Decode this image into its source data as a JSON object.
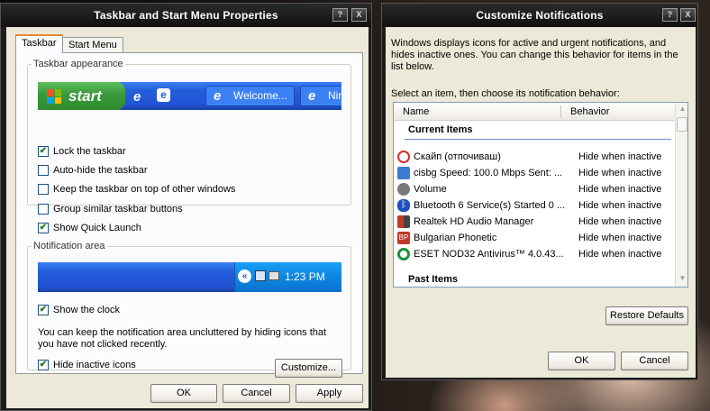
{
  "taskbar_window": {
    "title": "Taskbar and Start Menu Properties",
    "help_btn": "?",
    "close_btn": "X",
    "tabs": [
      "Taskbar",
      "Start Menu"
    ],
    "appearance_group": "Taskbar appearance",
    "preview": {
      "start": "start",
      "button1": "Welcome...",
      "button2": "Nin"
    },
    "options": [
      {
        "label": "Lock the taskbar",
        "checked": true
      },
      {
        "label": "Auto-hide the taskbar",
        "checked": false
      },
      {
        "label": "Keep the taskbar on top of other windows",
        "checked": false
      },
      {
        "label": "Group similar taskbar buttons",
        "checked": false
      },
      {
        "label": "Show Quick Launch",
        "checked": true
      }
    ],
    "notification_group": "Notification area",
    "clock_preview": "1:23 PM",
    "show_clock": "Show the clock",
    "info_text": "You can keep the notification area uncluttered by hiding icons that you have not clicked recently.",
    "hide_inactive": "Hide inactive icons",
    "customize": "Customize...",
    "ok": "OK",
    "cancel": "Cancel",
    "apply": "Apply"
  },
  "notify_window": {
    "title": "Customize Notifications",
    "help_btn": "?",
    "close_btn": "X",
    "description": "Windows displays icons for active and urgent notifications, and hides inactive ones. You can change this behavior for items in the list below.",
    "select_prompt": "Select an item, then choose its notification behavior:",
    "col_name": "Name",
    "col_behavior": "Behavior",
    "current_items": "Current Items",
    "past_items": "Past Items",
    "items": [
      {
        "name": "Скайп (отпочиваш)",
        "behavior": "Hide when inactive",
        "icon": "skype-icon",
        "color": "#d62e2e"
      },
      {
        "name": "cisbg Speed: 100.0 Mbps Sent: ...",
        "behavior": "Hide when inactive",
        "icon": "network-icon",
        "color": "#3a7bd5"
      },
      {
        "name": "Volume",
        "behavior": "Hide when inactive",
        "icon": "volume-icon",
        "color": "#7a7a7a"
      },
      {
        "name": "Bluetooth 6 Service(s) Started 0 ...",
        "behavior": "Hide when inactive",
        "icon": "bluetooth-icon",
        "color": "#1f4fbf"
      },
      {
        "name": "Realtek HD Audio Manager",
        "behavior": "Hide when inactive",
        "icon": "realtek-icon",
        "color": "#c0392b"
      },
      {
        "name": "Bulgarian Phonetic",
        "behavior": "Hide when inactive",
        "icon": "keyboard-layout-icon",
        "color": "#c0392b"
      },
      {
        "name": "ESET NOD32 Antivirus™ 4.0.43...",
        "behavior": "Hide when inactive",
        "icon": "eset-icon",
        "color": "#1f8f3a"
      }
    ],
    "restore_defaults": "Restore Defaults",
    "ok": "OK",
    "cancel": "Cancel"
  }
}
